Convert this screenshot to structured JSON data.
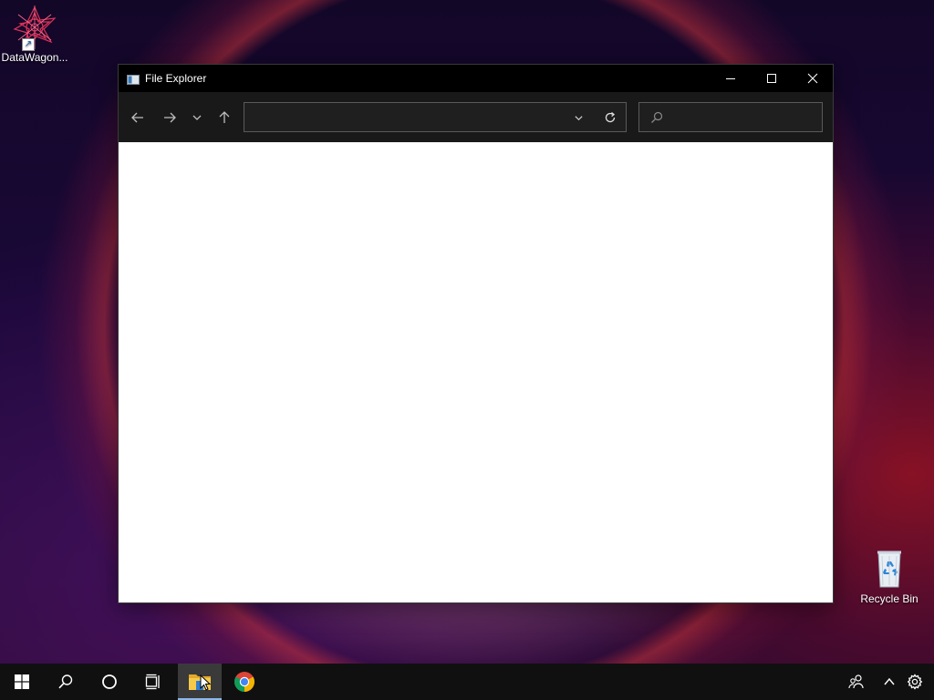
{
  "desktop": {
    "icons": [
      {
        "label": "DataWagon...",
        "icon": "datawagon-icon"
      },
      {
        "label": "Recycle Bin",
        "icon": "recycle-bin-icon"
      }
    ]
  },
  "window": {
    "title": "File Explorer",
    "controls": {
      "minimize": "minimize-icon",
      "maximize": "maximize-icon",
      "close": "close-icon"
    },
    "toolbar": {
      "back": "arrow-left-icon",
      "forward": "arrow-right-icon",
      "recent": "chevron-down-icon",
      "up": "arrow-up-icon",
      "address": {
        "value": "",
        "placeholder": ""
      },
      "address_dropdown": "chevron-down-icon",
      "refresh": "refresh-icon",
      "search": {
        "value": "",
        "placeholder": ""
      }
    }
  },
  "taskbar": {
    "items": [
      {
        "name": "start",
        "icon": "windows-logo-icon"
      },
      {
        "name": "search",
        "icon": "search-icon"
      },
      {
        "name": "cortana",
        "icon": "cortana-circle-icon"
      },
      {
        "name": "task-view",
        "icon": "task-view-icon"
      },
      {
        "name": "file-explorer",
        "icon": "folder-icon",
        "active": true
      },
      {
        "name": "chrome",
        "icon": "chrome-icon"
      }
    ],
    "tray": [
      {
        "name": "people",
        "icon": "people-icon"
      },
      {
        "name": "show-hidden-icons",
        "icon": "chevron-up-icon"
      },
      {
        "name": "settings",
        "icon": "gear-icon"
      }
    ]
  },
  "colors": {
    "titlebar": "#000000",
    "toolbar": "#191919",
    "content": "#ffffff",
    "taskbar": "#101010",
    "taskbar_active_indicator": "#8fb8e8"
  }
}
